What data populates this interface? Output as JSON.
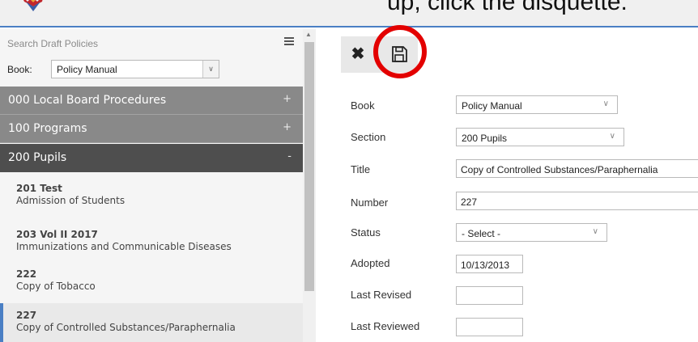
{
  "banner": {
    "text": "up, click the disquette."
  },
  "sidebar": {
    "search_placeholder": "Search Draft Policies",
    "book_label": "Book:",
    "book_value": "Policy Manual",
    "sections": [
      {
        "label": "000 Local Board Procedures",
        "sign": "+"
      },
      {
        "label": "100 Programs",
        "sign": "+"
      },
      {
        "label": "200 Pupils",
        "sign": "-"
      }
    ],
    "policies": [
      {
        "number": "201 Test",
        "name": "Admission of Students"
      },
      {
        "number": "203 Vol II 2017",
        "name": "Immunizations and Communicable Diseases"
      },
      {
        "number": "222",
        "name": "Copy of Tobacco"
      },
      {
        "number": "227",
        "name": "Copy of Controlled Substances/Paraphernalia"
      }
    ]
  },
  "form": {
    "book": {
      "label": "Book",
      "value": "Policy Manual"
    },
    "section": {
      "label": "Section",
      "value": "200 Pupils"
    },
    "title": {
      "label": "Title",
      "value": "Copy of Controlled Substances/Paraphernalia"
    },
    "number": {
      "label": "Number",
      "value": "227"
    },
    "status": {
      "label": "Status",
      "value": "- Select -"
    },
    "adopted": {
      "label": "Adopted",
      "value": "10/13/2013"
    },
    "last_revised": {
      "label": "Last Revised",
      "value": ""
    },
    "last_reviewed": {
      "label": "Last Reviewed",
      "value": ""
    }
  },
  "icons": {
    "close": "close-icon",
    "save": "save-floppy-icon",
    "menu": "hamburger-menu-icon"
  },
  "colors": {
    "accent": "#4a7fc4",
    "highlight": "#e30000",
    "section_grey": "#898989",
    "section_dark": "#4e4e4e"
  }
}
